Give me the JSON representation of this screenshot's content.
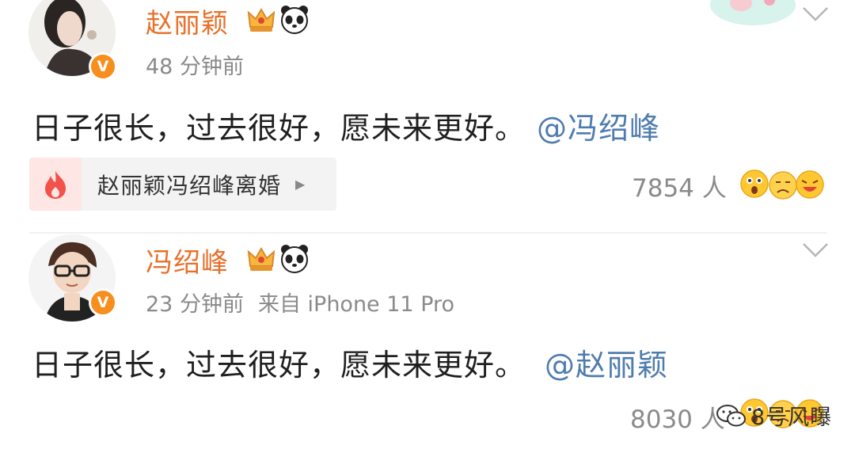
{
  "posts": [
    {
      "author": "赵丽颖",
      "time": "48 分钟前",
      "source": "",
      "text": "日子很长，过去很好，愿未来更好。",
      "mention": "@冯绍峰",
      "topic": "赵丽颖冯绍峰离婚",
      "reactions": "7854 人"
    },
    {
      "author": "冯绍峰",
      "time": "23 分钟前",
      "source": "来自 iPhone 11 Pro",
      "text": "日子很长，过去很好，愿未来更好。",
      "mention": "@赵丽颖",
      "reactions": "8030 人"
    }
  ],
  "watermark": "8号风曝",
  "icons": {
    "verified": "verified-v-badge-icon",
    "crown": "crown-icon",
    "panda": "panda-icon",
    "fire": "fire-icon",
    "chevron": "chevron-down-icon",
    "reaction": "reaction-emoji-icon",
    "wechat": "wechat-icon"
  },
  "badge_letter": "V",
  "colors": {
    "name": "#e8702a",
    "mention": "#4f7cae",
    "meta": "#8a8a8a",
    "fire": "#f2524a",
    "verified": "#f78e1e"
  }
}
